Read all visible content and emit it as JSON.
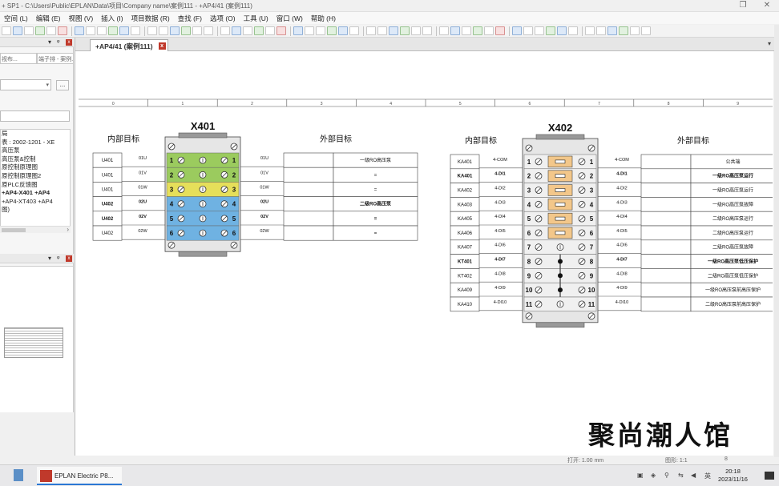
{
  "window": {
    "title": "+ SP1 - C:\\Users\\Public\\EPLAN\\Data\\项目\\Company name\\案例111 - +AP4/41 (案例111)"
  },
  "menu": [
    "空间 (L)",
    "编辑 (E)",
    "视图 (V)",
    "插入 (I)",
    "项目数据 (R)",
    "查找 (F)",
    "选项 (O)",
    "工具 (U)",
    "窗口 (W)",
    "帮助 (H)"
  ],
  "left_panel": {
    "tabs": [
      "视布...",
      "端子排 - 案例..."
    ],
    "dots": "...",
    "tree": [
      {
        "t": "局",
        "b": false
      },
      {
        "t": "表 : 2002-1201 - XE",
        "b": false
      },
      {
        "t": "高压泵",
        "b": false
      },
      {
        "t": "高压泵&控制",
        "b": false
      },
      {
        "t": "原控制原理图",
        "b": false
      },
      {
        "t": "原控制原理图2",
        "b": false
      },
      {
        "t": "原PLC反馈图",
        "b": false
      },
      {
        "t": "+AP4-X401 +AP4",
        "b": true
      },
      {
        "t": "+AP4-XT403 +AP4",
        "b": false
      },
      {
        "t": "图)",
        "b": false
      }
    ]
  },
  "doc_tab": {
    "label": "+AP4/41 (案例111)",
    "close": "x"
  },
  "drawing": {
    "grid_numbers": [
      "0",
      "1",
      "2",
      "3",
      "4",
      "5",
      "6",
      "7",
      "8",
      "9"
    ],
    "x401": {
      "title": "X401",
      "inner_header": "内部目标",
      "outer_header": "外部目标",
      "rows": [
        {
          "inner": "U401",
          "inw": "01U",
          "n": "1",
          "outw": "01U",
          "ext": "一级RO高压泵",
          "color": "#9bcb5e",
          "bold": false
        },
        {
          "inner": "U401",
          "inw": "01V",
          "n": "2",
          "outw": "01V",
          "ext": "=",
          "color": "#9bcb5e",
          "bold": false
        },
        {
          "inner": "U401",
          "inw": "01W",
          "n": "3",
          "outw": "01W",
          "ext": "=",
          "color": "#e6df5a",
          "bold": false
        },
        {
          "inner": "U402",
          "inw": "02U",
          "n": "4",
          "outw": "02U",
          "ext": "二级RO高压泵",
          "color": "#6fb2e2",
          "bold": true
        },
        {
          "inner": "U402",
          "inw": "02V",
          "n": "5",
          "outw": "02V",
          "ext": "=",
          "color": "#6fb2e2",
          "bold": true
        },
        {
          "inner": "U402",
          "inw": "02W",
          "n": "6",
          "outw": "02W",
          "ext": "=",
          "color": "#6fb2e2",
          "bold": false
        }
      ]
    },
    "x402": {
      "title": "X402",
      "inner_header": "内部目标",
      "outer_header": "外部目标",
      "rows": [
        {
          "inner": "KA401",
          "inw": "4-COM",
          "n": "1",
          "outw": "4-COM",
          "ext": "公共端",
          "type": "fuse",
          "bold": false
        },
        {
          "inner": "KA401",
          "inw": "4-DI1",
          "n": "2",
          "outw": "4-DI1",
          "ext": "一级RO高压泵运行",
          "type": "fuse",
          "bold": true
        },
        {
          "inner": "KA402",
          "inw": "4-DI2",
          "n": "3",
          "outw": "4-DI2",
          "ext": "一级RO高压泵运行",
          "type": "fuse",
          "bold": false
        },
        {
          "inner": "KA403",
          "inw": "4-DI3",
          "n": "4",
          "outw": "4-DI3",
          "ext": "一级RO高压泵故障",
          "type": "fuse",
          "bold": false
        },
        {
          "inner": "KA405",
          "inw": "4-DI4",
          "n": "5",
          "outw": "4-DI4",
          "ext": "二级RO高压泵运行",
          "type": "fuse",
          "bold": false
        },
        {
          "inner": "KA406",
          "inw": "4-DI5",
          "n": "6",
          "outw": "4-DI5",
          "ext": "二级RO高压泵运行",
          "type": "fuse",
          "bold": false
        },
        {
          "inner": "KA407",
          "inw": "4-DI6",
          "n": "7",
          "outw": "4-DI6",
          "ext": "二级RO高压泵故障",
          "type": "plain",
          "bold": false
        },
        {
          "inner": "KT401",
          "inw": "4-DI7",
          "n": "8",
          "outw": "4-DI7",
          "ext": "一级RO高压泵低压保护",
          "type": "bridge",
          "bold": true
        },
        {
          "inner": "KT402",
          "inw": "4-DI8",
          "n": "9",
          "outw": "4-DI8",
          "ext": "二级RO高压泵低压保护",
          "type": "bridge",
          "bold": false
        },
        {
          "inner": "KA409",
          "inw": "4-DI9",
          "n": "10",
          "outw": "4-DI9",
          "ext": "一级RO高压泵前高压保护",
          "type": "bridge",
          "bold": false
        },
        {
          "inner": "KA410",
          "inw": "4-DI10",
          "n": "11",
          "outw": "4-DI10",
          "ext": "二级RO高压泵前高压保护",
          "type": "plain",
          "bold": false
        }
      ]
    },
    "watermark": "聚尚潮人馆"
  },
  "status": {
    "coords": "打开: 1.00 mm",
    "grid": "图形: 1:1",
    "extra": "8"
  },
  "taskbar": {
    "app": "EPLAN Electric P8...",
    "time": "20:18",
    "date": "2023/11/16"
  }
}
